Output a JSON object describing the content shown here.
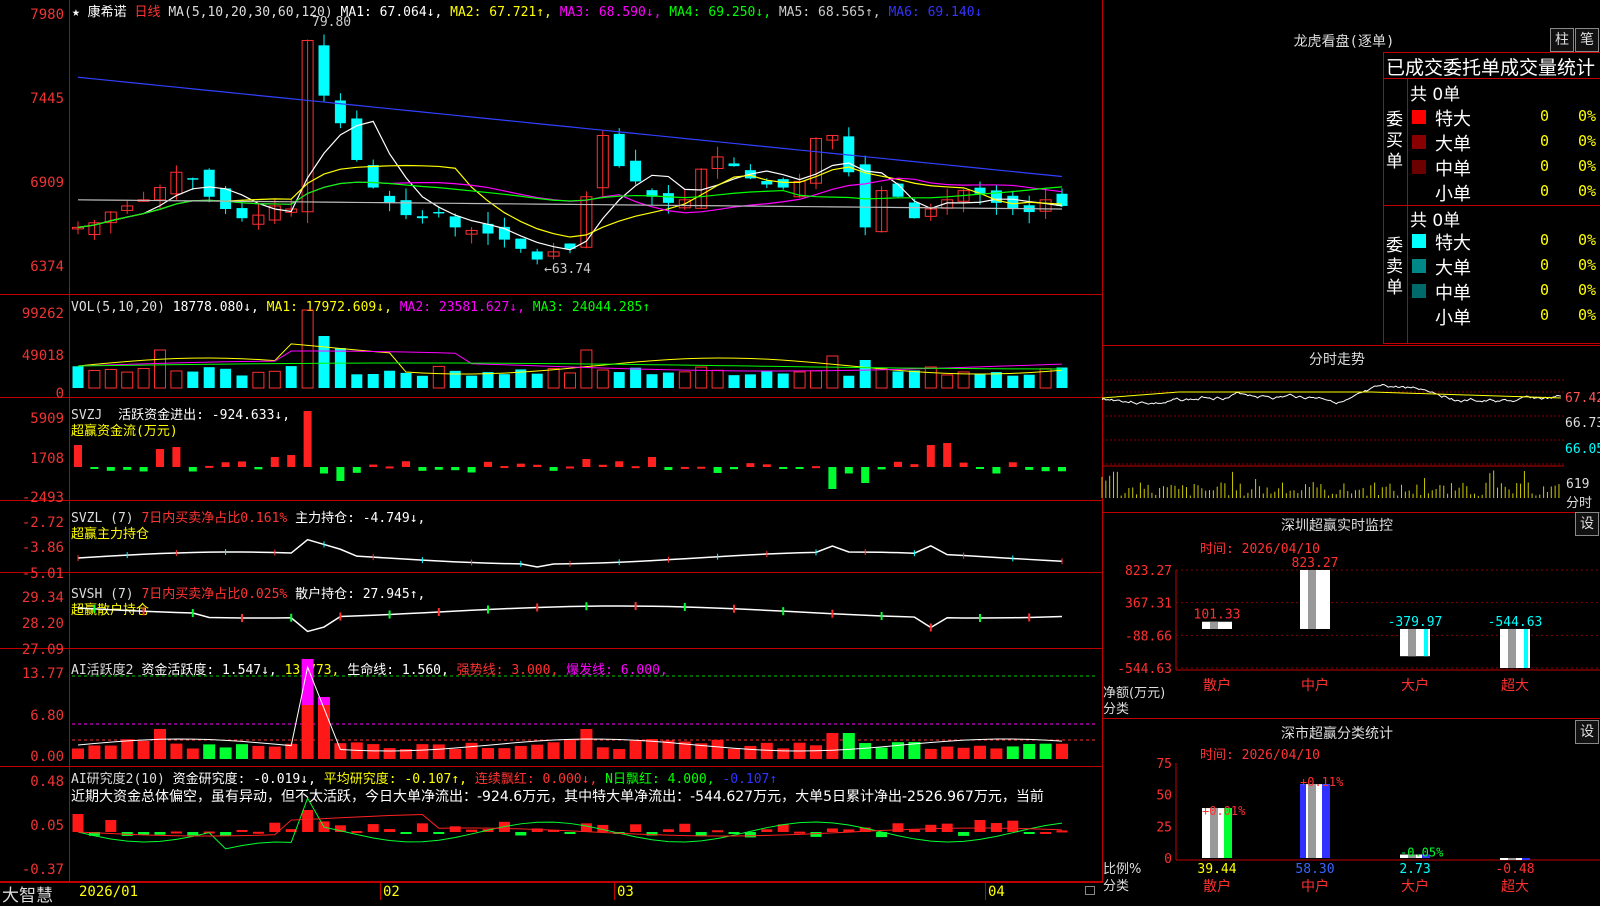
{
  "stock": {
    "name": "康希诺",
    "period": "日线",
    "star": "★"
  },
  "main": {
    "ma_label": "MA(5,10,20,30,60,120)",
    "ma1": "MA1: 67.064↓,",
    "ma2": "MA2: 67.721↑,",
    "ma3": "MA3: 68.590↓,",
    "ma4": "MA4: 69.250↓,",
    "ma5": "MA5: 68.565↑,",
    "ma6": "MA6: 69.140↓",
    "yticks": [
      "7980",
      "7445",
      "6909",
      "6374"
    ],
    "high_note": "79.80",
    "low_note": "←63.74"
  },
  "vol": {
    "label": "VOL(5,10,20)",
    "value": "18778.080↓,",
    "ma1": "MA1: 17972.609↓,",
    "ma2": "MA2: 23581.627↓,",
    "ma3": "MA3: 24044.285↑",
    "yticks": [
      "99262",
      "49018",
      "0"
    ]
  },
  "svzj": {
    "label": "SVZJ",
    "title": "活跃资金进出: -924.633↓,",
    "subtitle": "超赢资金流(万元)",
    "yticks": [
      "5909",
      "1708",
      "-2493"
    ]
  },
  "svzl": {
    "label": "SVZL (7)",
    "title": "7日内买卖净占比0.161%",
    "title2": "主力持仓: -4.749↓,",
    "subtitle": "超赢主力持仓",
    "yticks": [
      "-2.72",
      "-3.86",
      "-5.01"
    ]
  },
  "svsh": {
    "label": "SVSH (7)",
    "title": "7日内买卖净占比0.025%",
    "title2": "散户持仓: 27.945↑,",
    "subtitle": "超赢散户持仓",
    "yticks": [
      "29.34",
      "28.20",
      "27.09"
    ]
  },
  "ai1": {
    "label": "AI活跃度2",
    "v1": "资金活跃度: 1.547↓,",
    "v2": "13.773,",
    "v3": "生命线: 1.560,",
    "v4": "强势线: 3.000,",
    "v5": "爆发线: 6.000,",
    "yticks": [
      "13.77",
      "6.80",
      "0.00"
    ]
  },
  "ai2": {
    "label": "AI研究度2(10)",
    "v1": "资金研究度: -0.019↓,",
    "v2": "平均研究度: -0.107↑,",
    "v3": "连续飘红: 0.000↓,",
    "v4": "N日飘红: 4.000,",
    "v5": "-0.107↑",
    "comment": "近期大资金总体偏空，虽有异动，但不太活跃，今日大单净流出：-924.6万元，其中特大单净流出：-544.627万元，大单5日累计净出-2526.967万元，当前",
    "yticks": [
      "0.48",
      "0.05",
      "-0.37"
    ]
  },
  "xaxis": {
    "labels": [
      "2026/01",
      "02",
      "03",
      "04"
    ],
    "brand": "大智慧"
  },
  "right": {
    "title": "龙虎看盘(逐单)",
    "btn1": "柱",
    "btn2": "笔",
    "table_title": "已成交委托单成交量统计",
    "buy_side": "委买单",
    "sell_side": "委卖单",
    "buy_total": "共 0单",
    "sell_total": "共 0单",
    "buy_rows": [
      {
        "name": "特大",
        "count": "0",
        "pct": "0%"
      },
      {
        "name": "大单",
        "count": "0",
        "pct": "0%"
      },
      {
        "name": "中单",
        "count": "0",
        "pct": "0%"
      },
      {
        "name": "小单",
        "count": "0",
        "pct": "0%"
      }
    ],
    "sell_rows": [
      {
        "name": "特大",
        "count": "0",
        "pct": "0%"
      },
      {
        "name": "大单",
        "count": "0",
        "pct": "0%"
      },
      {
        "name": "中单",
        "count": "0",
        "pct": "0%"
      },
      {
        "name": "小单",
        "count": "0",
        "pct": "0%"
      }
    ],
    "colors": {
      "buy": [
        "#ff0000",
        "#880000",
        "#6a0000"
      ],
      "sell": [
        "#00ffff",
        "#008888",
        "#006a6a"
      ]
    }
  },
  "intraday": {
    "title": "分时走势",
    "yticks": [
      "67.42",
      "66.73",
      "66.05"
    ],
    "vol_tick": "619",
    "vol_label": "分时"
  },
  "monitor": {
    "title": "深圳超赢实时监控",
    "setting": "设",
    "time": "时间: 2026/04/10",
    "yticks": [
      "823.27",
      "367.31",
      "-88.66",
      "-544.63"
    ],
    "ylabel": "净额(万元)",
    "xlabel": "分类",
    "categories": [
      "散户",
      "中户",
      "大户",
      "超大"
    ],
    "values": [
      101.33,
      823.27,
      -379.97,
      -544.63
    ],
    "value_labels": [
      "101.33",
      "823.27",
      "-379.97",
      "-544.63"
    ]
  },
  "classify": {
    "title": "深市超赢分类统计",
    "setting": "设",
    "time": "时间: 2026/04/10",
    "yticks": [
      "75",
      "50",
      "25",
      "0"
    ],
    "ylabel": "比例%",
    "xlabel": "分类",
    "categories": [
      "散户",
      "中户",
      "大户",
      "超大"
    ],
    "values": [
      39.44,
      58.3,
      2.73,
      -0.48
    ],
    "value_labels": [
      "39.44",
      "58.30",
      "2.73",
      "-0.48"
    ],
    "diff_labels": [
      "+0.01%",
      "+0.11%",
      "-0.05%",
      ""
    ]
  },
  "chart_data": [
    {
      "type": "bar",
      "title": "深圳超赢实时监控",
      "categories": [
        "散户",
        "中户",
        "大户",
        "超大"
      ],
      "values": [
        101.33,
        823.27,
        -379.97,
        -544.63
      ],
      "ylabel": "净额(万元)",
      "xlabel": "分类",
      "ylim": [
        -544.63,
        823.27
      ]
    },
    {
      "type": "bar",
      "title": "深市超赢分类统计",
      "categories": [
        "散户",
        "中户",
        "大户",
        "超大"
      ],
      "values": [
        39.44,
        58.3,
        2.73,
        -0.48
      ],
      "ylabel": "比例%",
      "xlabel": "分类",
      "ylim": [
        0,
        75
      ]
    }
  ]
}
